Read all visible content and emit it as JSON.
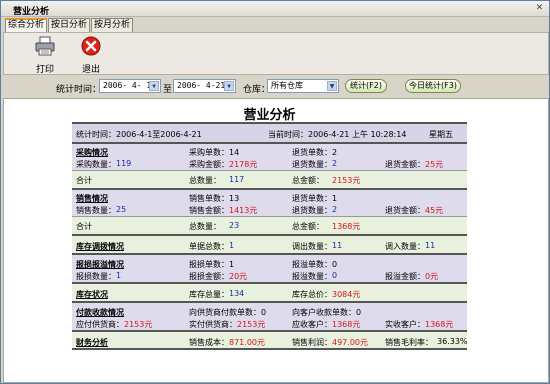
{
  "window": {
    "title": "营业分析"
  },
  "tabs": [
    "综合分析",
    "按日分析",
    "按月分析"
  ],
  "toolbar": {
    "print": "打印",
    "exit": "退出"
  },
  "filter": {
    "period_label": "统计时间：",
    "date_from": "2006- 4- 1",
    "to_label": "至",
    "date_to": "2006- 4-21",
    "warehouse_label": "仓库：",
    "warehouse": "所有仓库",
    "stat_button": "统计(F2)",
    "today_button": "今日统计(F3)"
  },
  "report": {
    "title": "营业分析",
    "period": "统计时间：2006-4-1至2006-4-21",
    "now_label": "当前时间：2006-4-21 上午 10:28:14",
    "weekday": "星期五",
    "purchase": {
      "header": "采购情况",
      "r1": [
        "采购单数：14",
        "退货单数：2"
      ],
      "r2": [
        "采购数量：",
        "119",
        "采购金额：",
        "2178元",
        "退货数量：",
        "2",
        "退货金额：",
        "25元"
      ],
      "total": [
        "合计",
        "总数量：",
        "117",
        "总金额：",
        "2153元"
      ]
    },
    "sales": {
      "header": "销售情况",
      "r1": [
        "销售单数：13",
        "退货单数：1"
      ],
      "r2": [
        "销售数量：",
        "25",
        "销售金额：",
        "1413元",
        "退货数量：",
        "2",
        "退货金额：",
        "45元"
      ],
      "total": [
        "合计",
        "总数量：",
        "23",
        "总金额：",
        "1368元"
      ]
    },
    "transfer": {
      "header": "库存调拨情况",
      "cells": [
        "单据总数：",
        "1",
        "调出数量：",
        "11",
        "调入数量：",
        "11"
      ]
    },
    "loss": {
      "header": "报损报溢情况",
      "r1": [
        "报损单数：1",
        "报溢单数：0"
      ],
      "r2": [
        "报损数量：",
        "1",
        "报损金额：",
        "20元",
        "报溢数量：",
        "0",
        "报溢金额：",
        "0元"
      ]
    },
    "stock": {
      "header": "库存状况",
      "cells": [
        "库存总量：",
        "134",
        "库存总价：",
        "3084元"
      ]
    },
    "payments": {
      "header": "付款收款情况",
      "r1": [
        "向供货商付款单数：0",
        "向客户收款单数：0"
      ],
      "r2": [
        "应付供货商：",
        "2153元",
        "实付供货商：",
        "2153元",
        "应收客户：",
        "1368元",
        "实收客户：",
        "1368元"
      ]
    },
    "finance": {
      "header": "财务分析",
      "cells": [
        "销售成本：",
        "871.00元",
        "销售利润：",
        "497.00元",
        "销售毛利率：",
        "36.33%"
      ]
    }
  }
}
